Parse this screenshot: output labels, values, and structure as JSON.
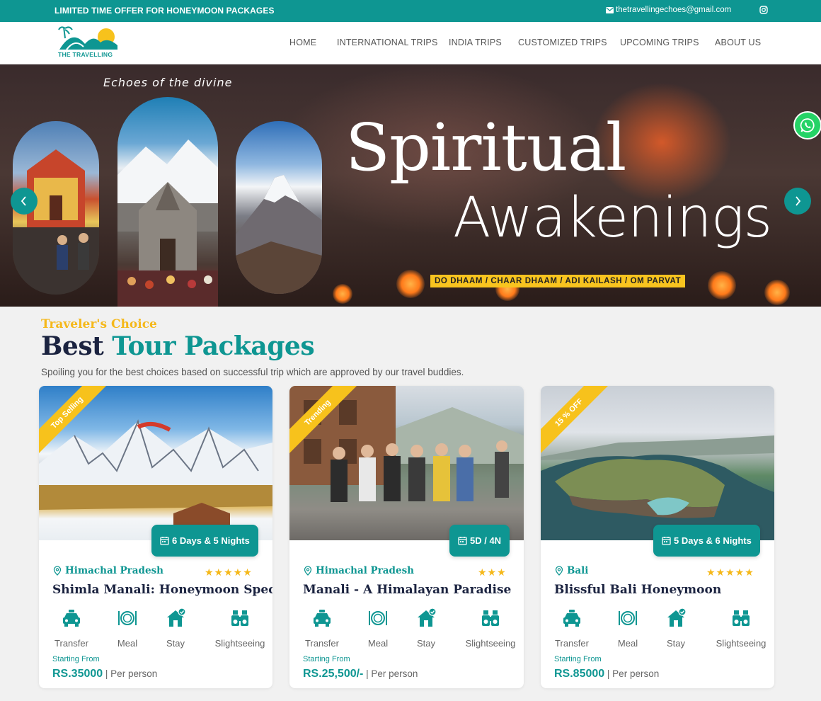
{
  "topbar": {
    "offer": "LIMITED TIME OFFER FOR HONEYMOON PACKAGES",
    "email": "thetravellingechoes@gmail.com",
    "email_icon": "envelope-icon",
    "social_icon": "instagram-icon"
  },
  "header": {
    "logo_text": "THE TRAVELLING",
    "nav": [
      "HOME",
      "INTERNATIONAL TRIPS",
      "INDIA TRIPS",
      "CUSTOMIZED TRIPS",
      "UPCOMING TRIPS",
      "ABOUT US"
    ]
  },
  "hero": {
    "tagline": "Echoes of the divine",
    "headline_1": "Spiritual",
    "headline_2": "Awakenings",
    "destinations": "DO DHAAM / CHAAR DHAAM / ADI KAILASH / OM PARVAT",
    "prev_icon": "chevron-left-icon",
    "next_icon": "chevron-right-icon",
    "chat_icon": "whatsapp-icon"
  },
  "section": {
    "kicker": "Traveler's Choice",
    "title_1": "Best",
    "title_2": "Tour Packages",
    "subtitle": "Spoiling you for the best choices based on successful trip which are approved by our travel buddies."
  },
  "packages": [
    {
      "ribbon": "Top Selling",
      "duration": "6 Days & 5 Nights",
      "location": "Himachal Pradesh",
      "rating": 5,
      "stars": "★★★★★",
      "name": "Shimla Manali: Honeymoon Special",
      "starting_from": "Starting From",
      "price": "RS.35000",
      "per": " | Per person"
    },
    {
      "ribbon": "Trending",
      "duration": "5D / 4N",
      "location": "Himachal Pradesh",
      "rating": 3,
      "stars": "★★★",
      "name": "Manali - A Himalayan Paradise",
      "starting_from": "Starting From",
      "price": "RS.25,500/-",
      "per": " | Per person"
    },
    {
      "ribbon": "15 % OFF",
      "duration": "5 Days & 6 Nights",
      "location": "Bali",
      "rating": 5,
      "stars": "★★★★★",
      "name": "Blissful Bali Honeymoon",
      "starting_from": "Starting From",
      "price": "RS.85000",
      "per": " | Per person"
    }
  ],
  "amenities": [
    "Transfer",
    "Meal",
    "Stay",
    "Slightseeing"
  ],
  "colors": {
    "brand": "#0e9692",
    "accent": "#f5b81a",
    "heading": "#1b2340"
  }
}
